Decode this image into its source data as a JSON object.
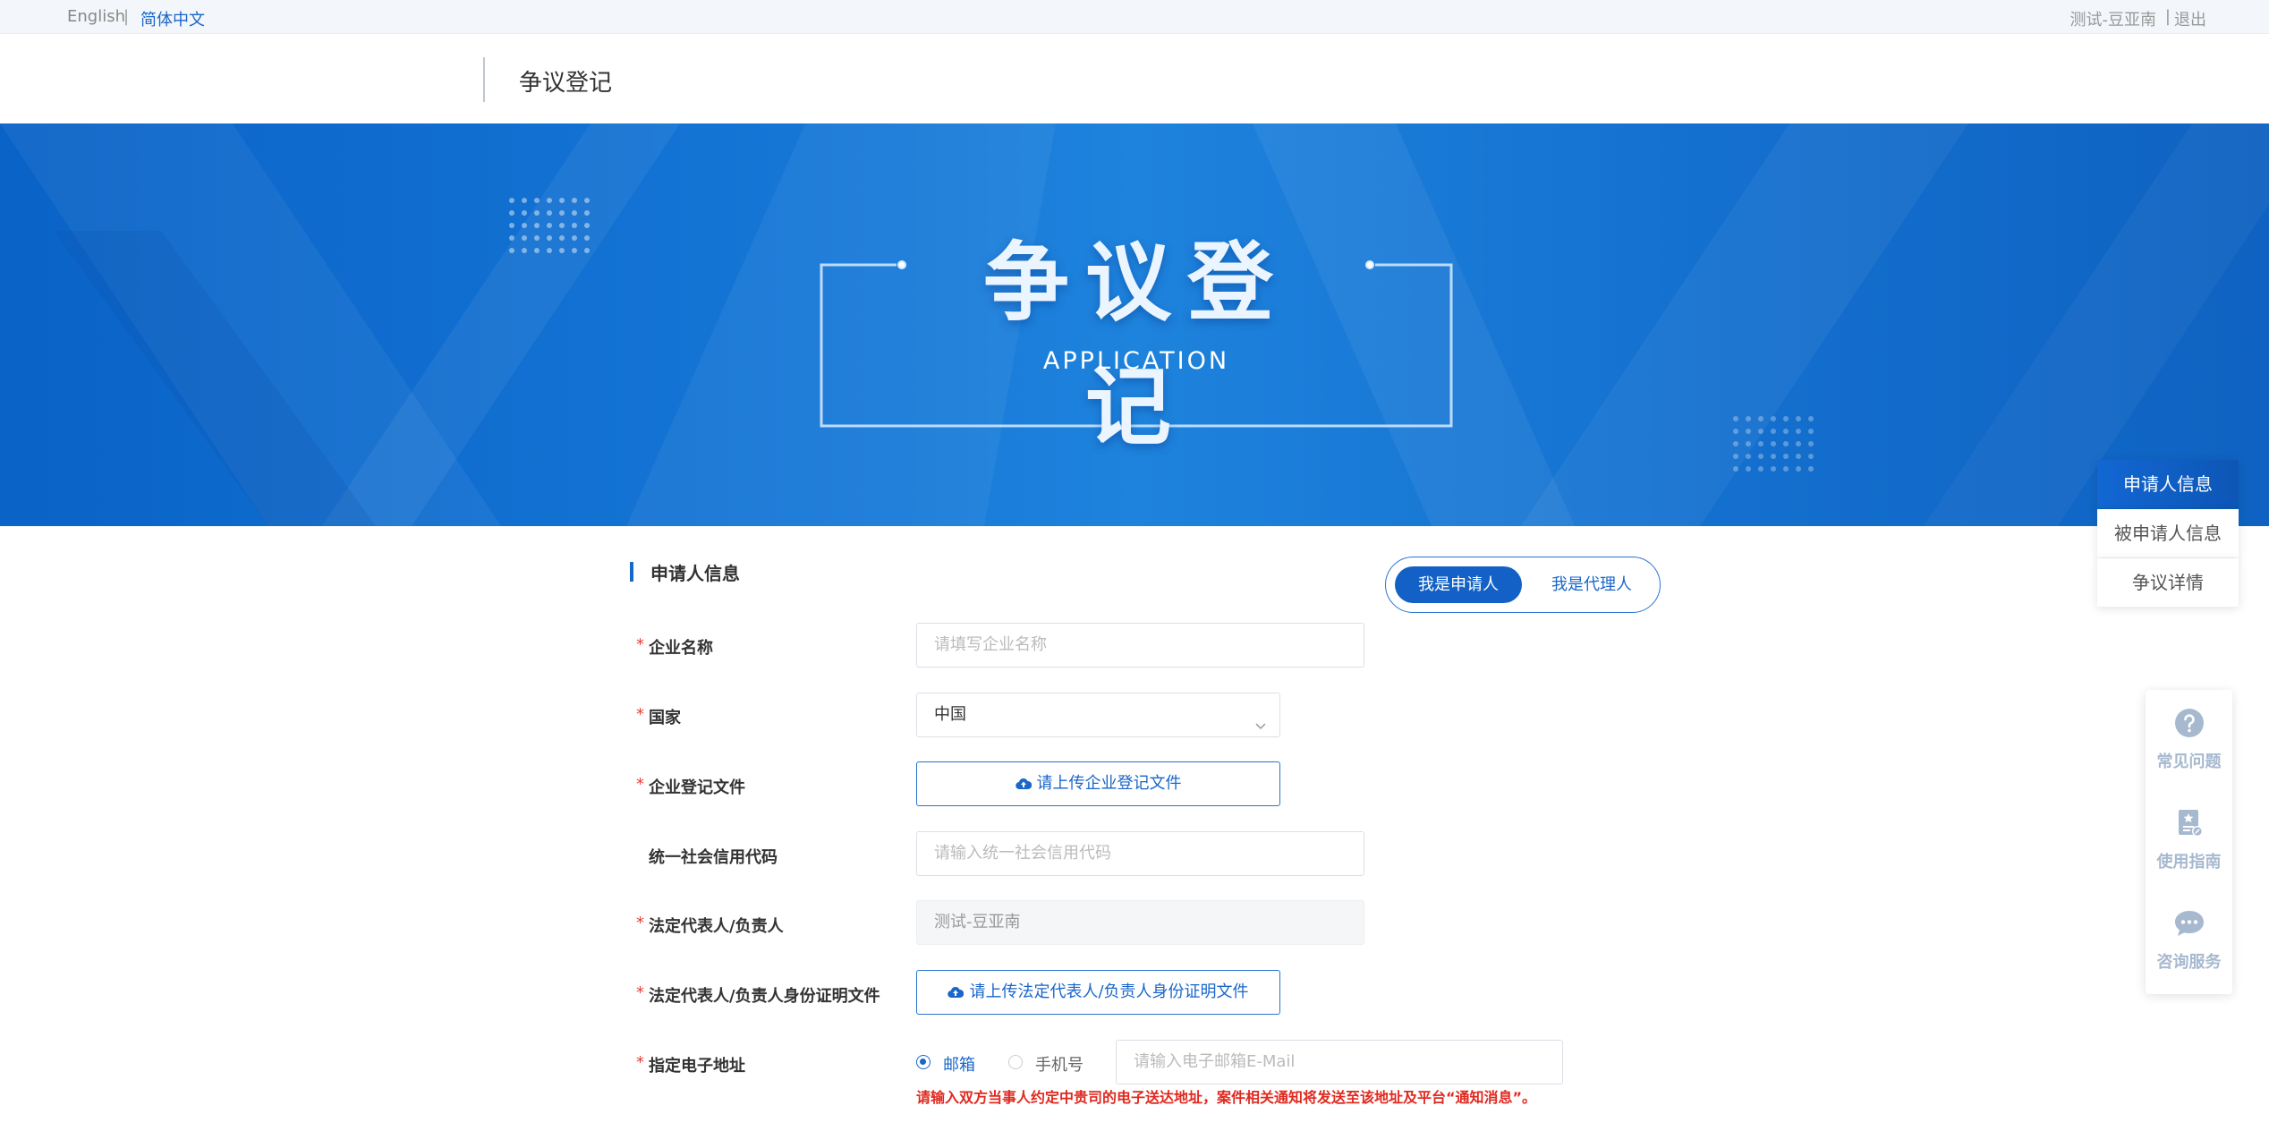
{
  "topbar": {
    "lang_en": "English",
    "lang_sep": "|",
    "lang_cn": "简体中文",
    "user_name": "测试-豆亚南",
    "user_sep": "|",
    "logout": "退出"
  },
  "header": {
    "title": "争议登记"
  },
  "banner": {
    "title": "争议登记",
    "subtitle": "APPLICATION"
  },
  "form": {
    "section_title": "申请人信息",
    "role_toggle": {
      "applicant": "我是申请人",
      "agent": "我是代理人",
      "selected": "我是申请人"
    },
    "required_mark": "*",
    "company_name": {
      "label": "企业名称",
      "placeholder": "请填写企业名称"
    },
    "country": {
      "label": "国家",
      "value": "中国"
    },
    "registration_file": {
      "label": "企业登记文件",
      "button": "请上传企业登记文件"
    },
    "credit_code": {
      "label": "统一社会信用代码",
      "placeholder": "请输入统一社会信用代码"
    },
    "legal_rep": {
      "label": "法定代表人/负责人",
      "value": "测试-豆亚南"
    },
    "legal_rep_id": {
      "label": "法定代表人/负责人身份证明文件",
      "button": "请上传法定代表人/负责人身份证明文件"
    },
    "email_address": {
      "label": "指定电子地址",
      "option_email": "邮箱",
      "option_phone": "手机号",
      "selected": "邮箱",
      "placeholder": "请输入电子邮箱E-Mail",
      "warning": "请输入双方当事人约定中贵司的电子送达地址，案件相关通知将发送至该地址及平台“通知消息”。"
    }
  },
  "sidenav": {
    "items": [
      "申请人信息",
      "被申请人信息",
      "争议详情"
    ],
    "active": "申请人信息"
  },
  "help": {
    "faq": "常见问题",
    "guide": "使用指南",
    "consult": "咨询服务"
  },
  "colors": {
    "primary": "#1a66c9",
    "banner_dark": "#0a63c7",
    "required": "#e0413b",
    "warning": "#e0291f"
  }
}
